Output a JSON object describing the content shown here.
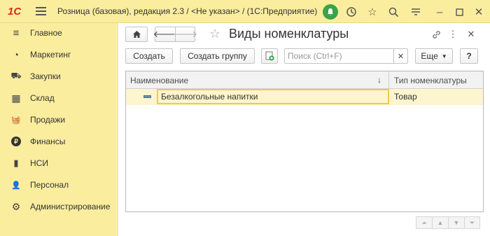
{
  "app": {
    "title": "Розница (базовая), редакция 2.3 / <Не указан> /  (1С:Предприятие)",
    "logo_text": "1С"
  },
  "sidebar": {
    "items": [
      {
        "label": "Главное",
        "icon": "menu-lines-icon",
        "glyph": "≡"
      },
      {
        "label": "Маркетинг",
        "icon": "pie-chart-icon",
        "glyph": "◔"
      },
      {
        "label": "Закупки",
        "icon": "truck-icon",
        "glyph": "⛟"
      },
      {
        "label": "Склад",
        "icon": "warehouse-grid-icon",
        "glyph": "▦"
      },
      {
        "label": "Продажи",
        "icon": "basket-icon",
        "glyph": "🧺"
      },
      {
        "label": "Финансы",
        "icon": "ruble-coin-icon",
        "glyph": "₽"
      },
      {
        "label": "НСИ",
        "icon": "books-icon",
        "glyph": "▮"
      },
      {
        "label": "Персонал",
        "icon": "person-icon",
        "glyph": "👤"
      },
      {
        "label": "Администрирование",
        "icon": "gear-icon",
        "glyph": "⚙"
      }
    ]
  },
  "form": {
    "title": "Виды номенклатуры",
    "create_label": "Создать",
    "create_group_label": "Создать группу",
    "search_placeholder": "Поиск (Ctrl+F)",
    "more_label": "Еще",
    "help_label": "?"
  },
  "table": {
    "columns": [
      "Наименование",
      "Тип номенклатуры"
    ],
    "rows": [
      {
        "name": "Безалкогольные напитки",
        "type": "Товар"
      }
    ]
  },
  "colors": {
    "accent_yellow": "#fbed9e",
    "selection_border": "#f2c94c",
    "notification_green": "#3aa346",
    "logo_red": "#d52b1e"
  }
}
